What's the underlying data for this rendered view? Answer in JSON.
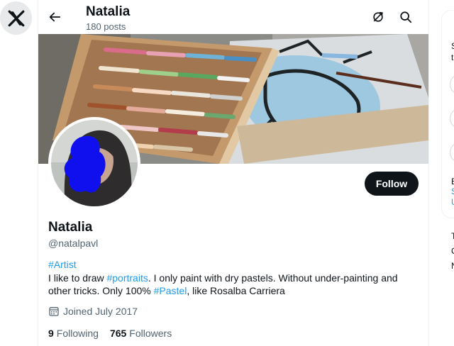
{
  "header": {
    "title": "Natalia",
    "posts": "180 posts"
  },
  "profile": {
    "display_name": "Natalia",
    "handle": "@natalpavl",
    "follow_label": "Follow",
    "bio": {
      "hashtag_artist": "#Artist",
      "text_1": "I like to draw ",
      "hashtag_portraits": "#portraits",
      "text_2": ". I only paint with dry pastels. Without under-painting and other tricks. Only 100% ",
      "hashtag_pastel": "#Pastel",
      "text_3": ", like Rosalba Carriera"
    },
    "joined": "Joined July 2017",
    "following_count": "9",
    "following_label": "Following",
    "followers_count": "765",
    "followers_label": "Followers"
  },
  "right_column": {
    "letters": [
      "S",
      "ti",
      "B",
      "S",
      "U",
      "T",
      "C",
      "N"
    ]
  },
  "icons": {
    "logo": "x-logo-icon",
    "back": "arrow-left-icon",
    "refresh": "refresh-icon",
    "search": "search-icon",
    "calendar": "calendar-icon"
  },
  "colors": {
    "link": "#1d9bf0",
    "follow_bg": "#0f1419",
    "secondary_text": "#536471"
  }
}
